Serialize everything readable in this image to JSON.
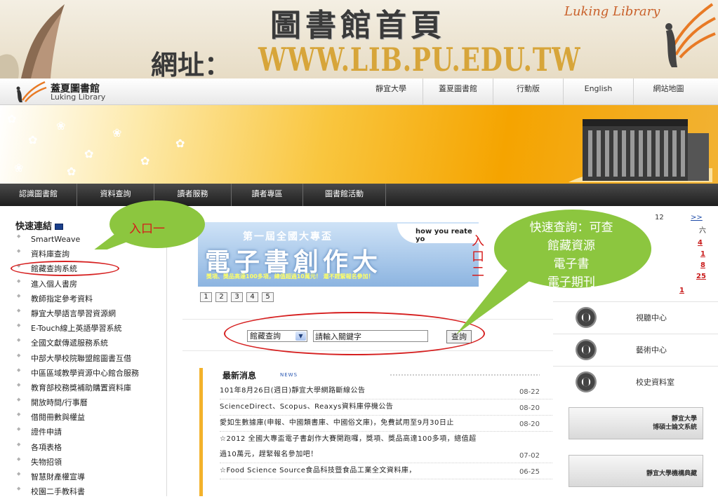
{
  "slide": {
    "title": "圖書館首頁",
    "url_label": "網址：",
    "url": "WWW.LIB.PU.EDU.TW",
    "brand": "Luking  Library"
  },
  "header": {
    "site_name": "蓋夏圖書館",
    "site_name_en": "Luking  Library",
    "top_links": [
      "靜宜大學",
      "蓋夏圖書館",
      "行動版",
      "English",
      "網站地圖"
    ]
  },
  "nav": {
    "items": [
      "認識圖書館",
      "資料查詢",
      "讀者服務",
      "讀者專區",
      "圖書館活動"
    ]
  },
  "quick_links": {
    "title": "快速連結",
    "items": [
      "SmartWeave",
      "資料庫查詢",
      "館藏查詢系統",
      "進入個人書房",
      "教師指定參考資料",
      "靜宜大學語言學習資源網",
      "E-Touch線上英語學習系統",
      "全國文獻傳遞服務系統",
      "中部大學校院聯盟館圖書互借",
      "中區區域教學資源中心館合服務",
      "教育部校務獎補助購置資料庫",
      "開放時間/行事曆",
      "借閱冊數與權益",
      "證件申請",
      "各項表格",
      "失物招領",
      "智慧財產權宣導",
      "校園二手教科書"
    ]
  },
  "annotations": {
    "entry1": "入口一",
    "entry2": "入口二",
    "callout2_lines": [
      "快速查詢：可查",
      "館藏資源",
      "電子書",
      "電子期刊"
    ]
  },
  "promo": {
    "small_title": "第一屆全國大專盃",
    "big_title": "電子書創作大",
    "subtitle": "獎項、獎品高達100多項，總值超過10萬元！ 還不趕緊報名參加！",
    "brand": "how you  reate yo"
  },
  "pager": [
    "1",
    "2",
    "3",
    "4",
    "5"
  ],
  "search": {
    "select_value": "館藏查詢",
    "input_value": "請輸入關鍵字",
    "button": "查詢"
  },
  "news": {
    "title": "最新消息",
    "badge": "NEWS",
    "items": [
      {
        "text": "101年8月26日(週日)靜宜大學網路斷線公告",
        "date": "08-22"
      },
      {
        "text": "ScienceDirect、Scopus、Reaxys資料庫停機公告",
        "date": "08-20"
      },
      {
        "text": "愛如生數據庫(申報、中國類書庫、中國俗文庫)，免費試用至9月30日止",
        "date": "08-20"
      },
      {
        "text": "☆2012 全國大專盃電子書創作大賽開跑囉，獎項、獎品高達100多項，總值超過10萬元，趕緊報名參加吧！",
        "date": "07-02"
      },
      {
        "text": "☆Food Science Source食品科技暨食品工業全文資料庫，",
        "date": "06-25"
      }
    ]
  },
  "calendar": {
    "month_fragment": "12",
    "next": ">>",
    "weekday": "六",
    "days": [
      "4",
      "1",
      "8",
      "25",
      "1"
    ]
  },
  "services": [
    "視聽中心",
    "藝術中心",
    "校史資料室"
  ],
  "thumbs": [
    {
      "line1": "靜宜大學",
      "line2": "博碩士論文系統"
    },
    {
      "line1": "靜宜大學機構典藏",
      "line2": ""
    }
  ],
  "colors": {
    "accent_orange": "#f3b22c",
    "callout_green": "#8cc63f",
    "annotation_red": "#d62020",
    "nav_dark": "#2b2b2b"
  }
}
